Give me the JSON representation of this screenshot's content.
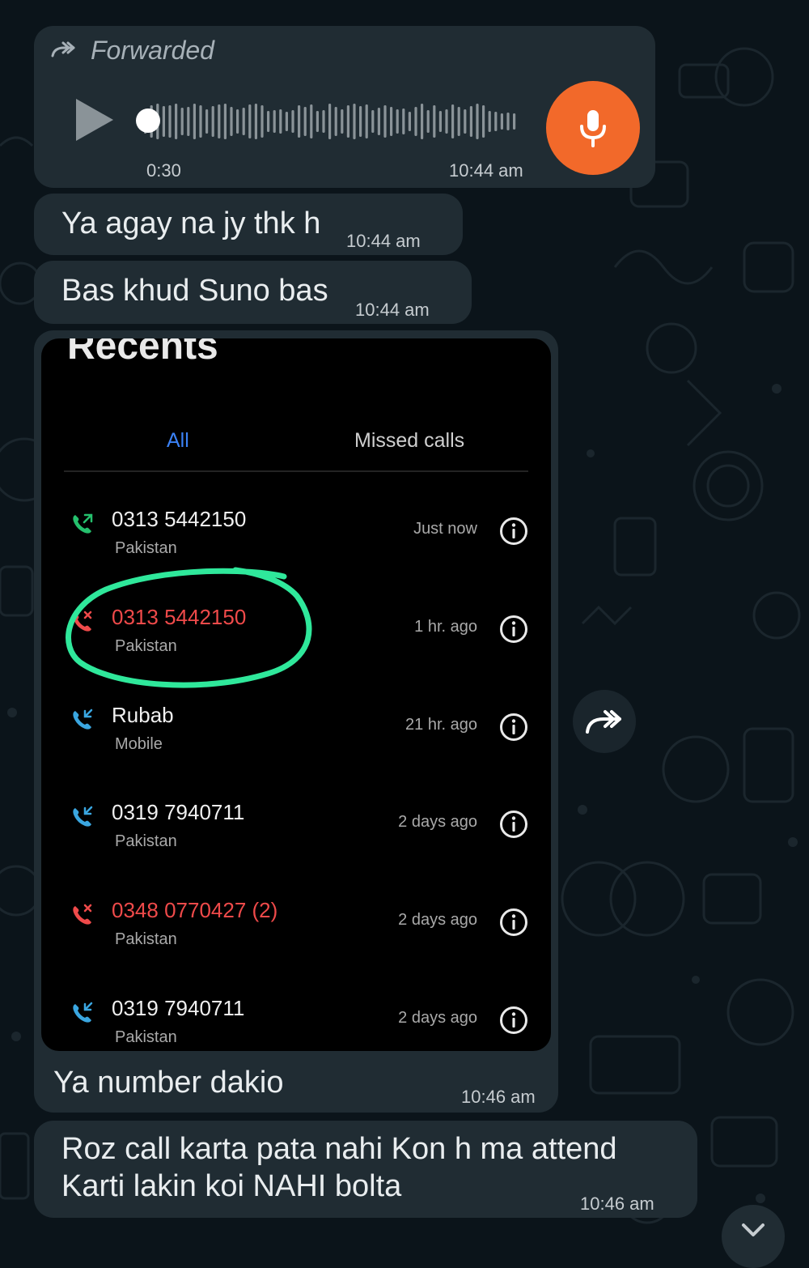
{
  "voice_message": {
    "forwarded_label": "Forwarded",
    "duration": "0:30",
    "time": "10:44 am",
    "progress": 0
  },
  "messages": [
    {
      "text": "Ya agay na jy thk h",
      "time": "10:44 am"
    },
    {
      "text": "Bas khud Suno bas",
      "time": "10:44 am"
    }
  ],
  "image_message": {
    "caption": "Ya number dakio",
    "time": "10:46 am",
    "screenshot": {
      "heading": "Recents",
      "tabs": [
        {
          "label": "All",
          "active": true
        },
        {
          "label": "Missed calls",
          "active": false
        }
      ],
      "calls": [
        {
          "name": "0313 5442150",
          "sub": "Pakistan",
          "time": "Just now",
          "type": "outgoing",
          "missed": false
        },
        {
          "name": "0313 5442150",
          "sub": "Pakistan",
          "time": "1 hr. ago",
          "type": "missed",
          "missed": true,
          "circled": true
        },
        {
          "name": "Rubab",
          "sub": "Mobile",
          "time": "21 hr. ago",
          "type": "incoming",
          "missed": false
        },
        {
          "name": "0319 7940711",
          "sub": "Pakistan",
          "time": "2 days ago",
          "type": "incoming",
          "missed": false
        },
        {
          "name": "0348 0770427 (2)",
          "sub": "Pakistan",
          "time": "2 days ago",
          "type": "missed",
          "missed": true
        },
        {
          "name": "0319 7940711",
          "sub": "Pakistan",
          "time": "2 days ago",
          "type": "incoming",
          "missed": false
        }
      ]
    }
  },
  "last_message": {
    "line1": "Roz call karta pata nahi Kon h ma attend",
    "line2": "Karti lakin koi NAHI bolta",
    "time": "10:46 am"
  },
  "colors": {
    "background": "#0b141a",
    "bubble": "#202c33",
    "mic_button": "#f2692a",
    "outgoing_call": "#25c06d",
    "missed_call": "#ef4a4a",
    "incoming_call": "#3aa6e0",
    "active_tab": "#3b82f6",
    "circle_annotation": "#2fe89b"
  }
}
